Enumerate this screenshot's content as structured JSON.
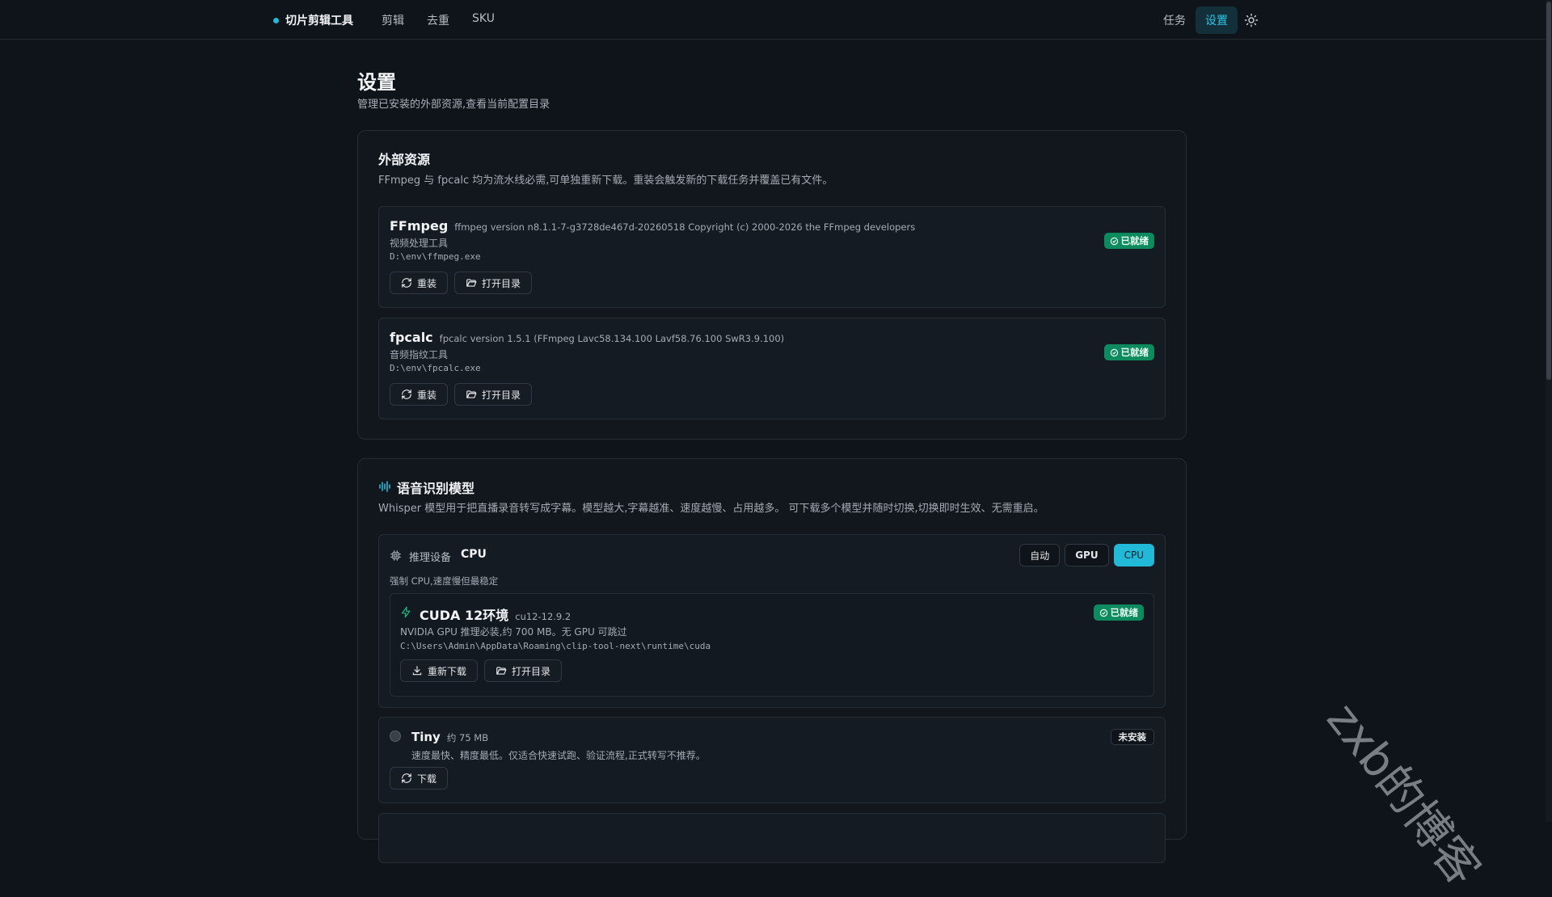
{
  "app": {
    "brand": "切片剪辑工具"
  },
  "nav": {
    "left": [
      "剪辑",
      "去重",
      "SKU"
    ],
    "right": [
      "任务",
      "设置"
    ]
  },
  "page": {
    "title": "设置",
    "subtitle": "管理已安装的外部资源,查看当前配置目录"
  },
  "external": {
    "title": "外部资源",
    "desc": "FFmpeg 与 fpcalc 均为流水线必需,可单独重新下载。重装会触发新的下载任务并覆盖已有文件。",
    "items": [
      {
        "name": "FFmpeg",
        "version": "ffmpeg version n8.1.1-7-g3728de467d-20260518 Copyright (c) 2000-2026 the FFmpeg developers",
        "desc": "视频处理工具",
        "path": "D:\\env\\ffmpeg.exe",
        "status": "已就绪",
        "reinstall": "重装",
        "open": "打开目录"
      },
      {
        "name": "fpcalc",
        "version": "fpcalc version 1.5.1 (FFmpeg Lavc58.134.100 Lavf58.76.100 SwR3.9.100)",
        "desc": "音频指纹工具",
        "path": "D:\\env\\fpcalc.exe",
        "status": "已就绪",
        "reinstall": "重装",
        "open": "打开目录"
      }
    ]
  },
  "asr": {
    "title": "语音识别模型",
    "desc": "Whisper 模型用于把直播录音转写成字幕。模型越大,字幕越准、速度越慢、占用越多。 可下载多个模型并随时切换,切换即时生效、无需重启。",
    "device": {
      "label": "推理设备",
      "value": "CPU",
      "note": "强制 CPU,速度慢但最稳定",
      "options": [
        "自动",
        "GPU",
        "CPU"
      ],
      "selected": "CPU"
    },
    "cuda": {
      "name": "CUDA 12环境",
      "version": "cu12-12.9.2",
      "desc": "NVIDIA GPU 推理必装,约 700 MB。无 GPU 可跳过",
      "path": "C:\\Users\\Admin\\AppData\\Roaming\\clip-tool-next\\runtime\\cuda",
      "status": "已就绪",
      "redownload": "重新下载",
      "open": "打开目录"
    },
    "models": [
      {
        "name": "Tiny",
        "size": "约 75 MB",
        "desc": "速度最快、精度最低。仅适合快速试跑、验证流程,正式转写不推荐。",
        "status": "未安装",
        "download": "下载"
      }
    ]
  },
  "watermark": "zxb的博客",
  "colors": {
    "accent": "#22b8d8",
    "success": "#0e8a5f",
    "background": "#0f131a"
  }
}
